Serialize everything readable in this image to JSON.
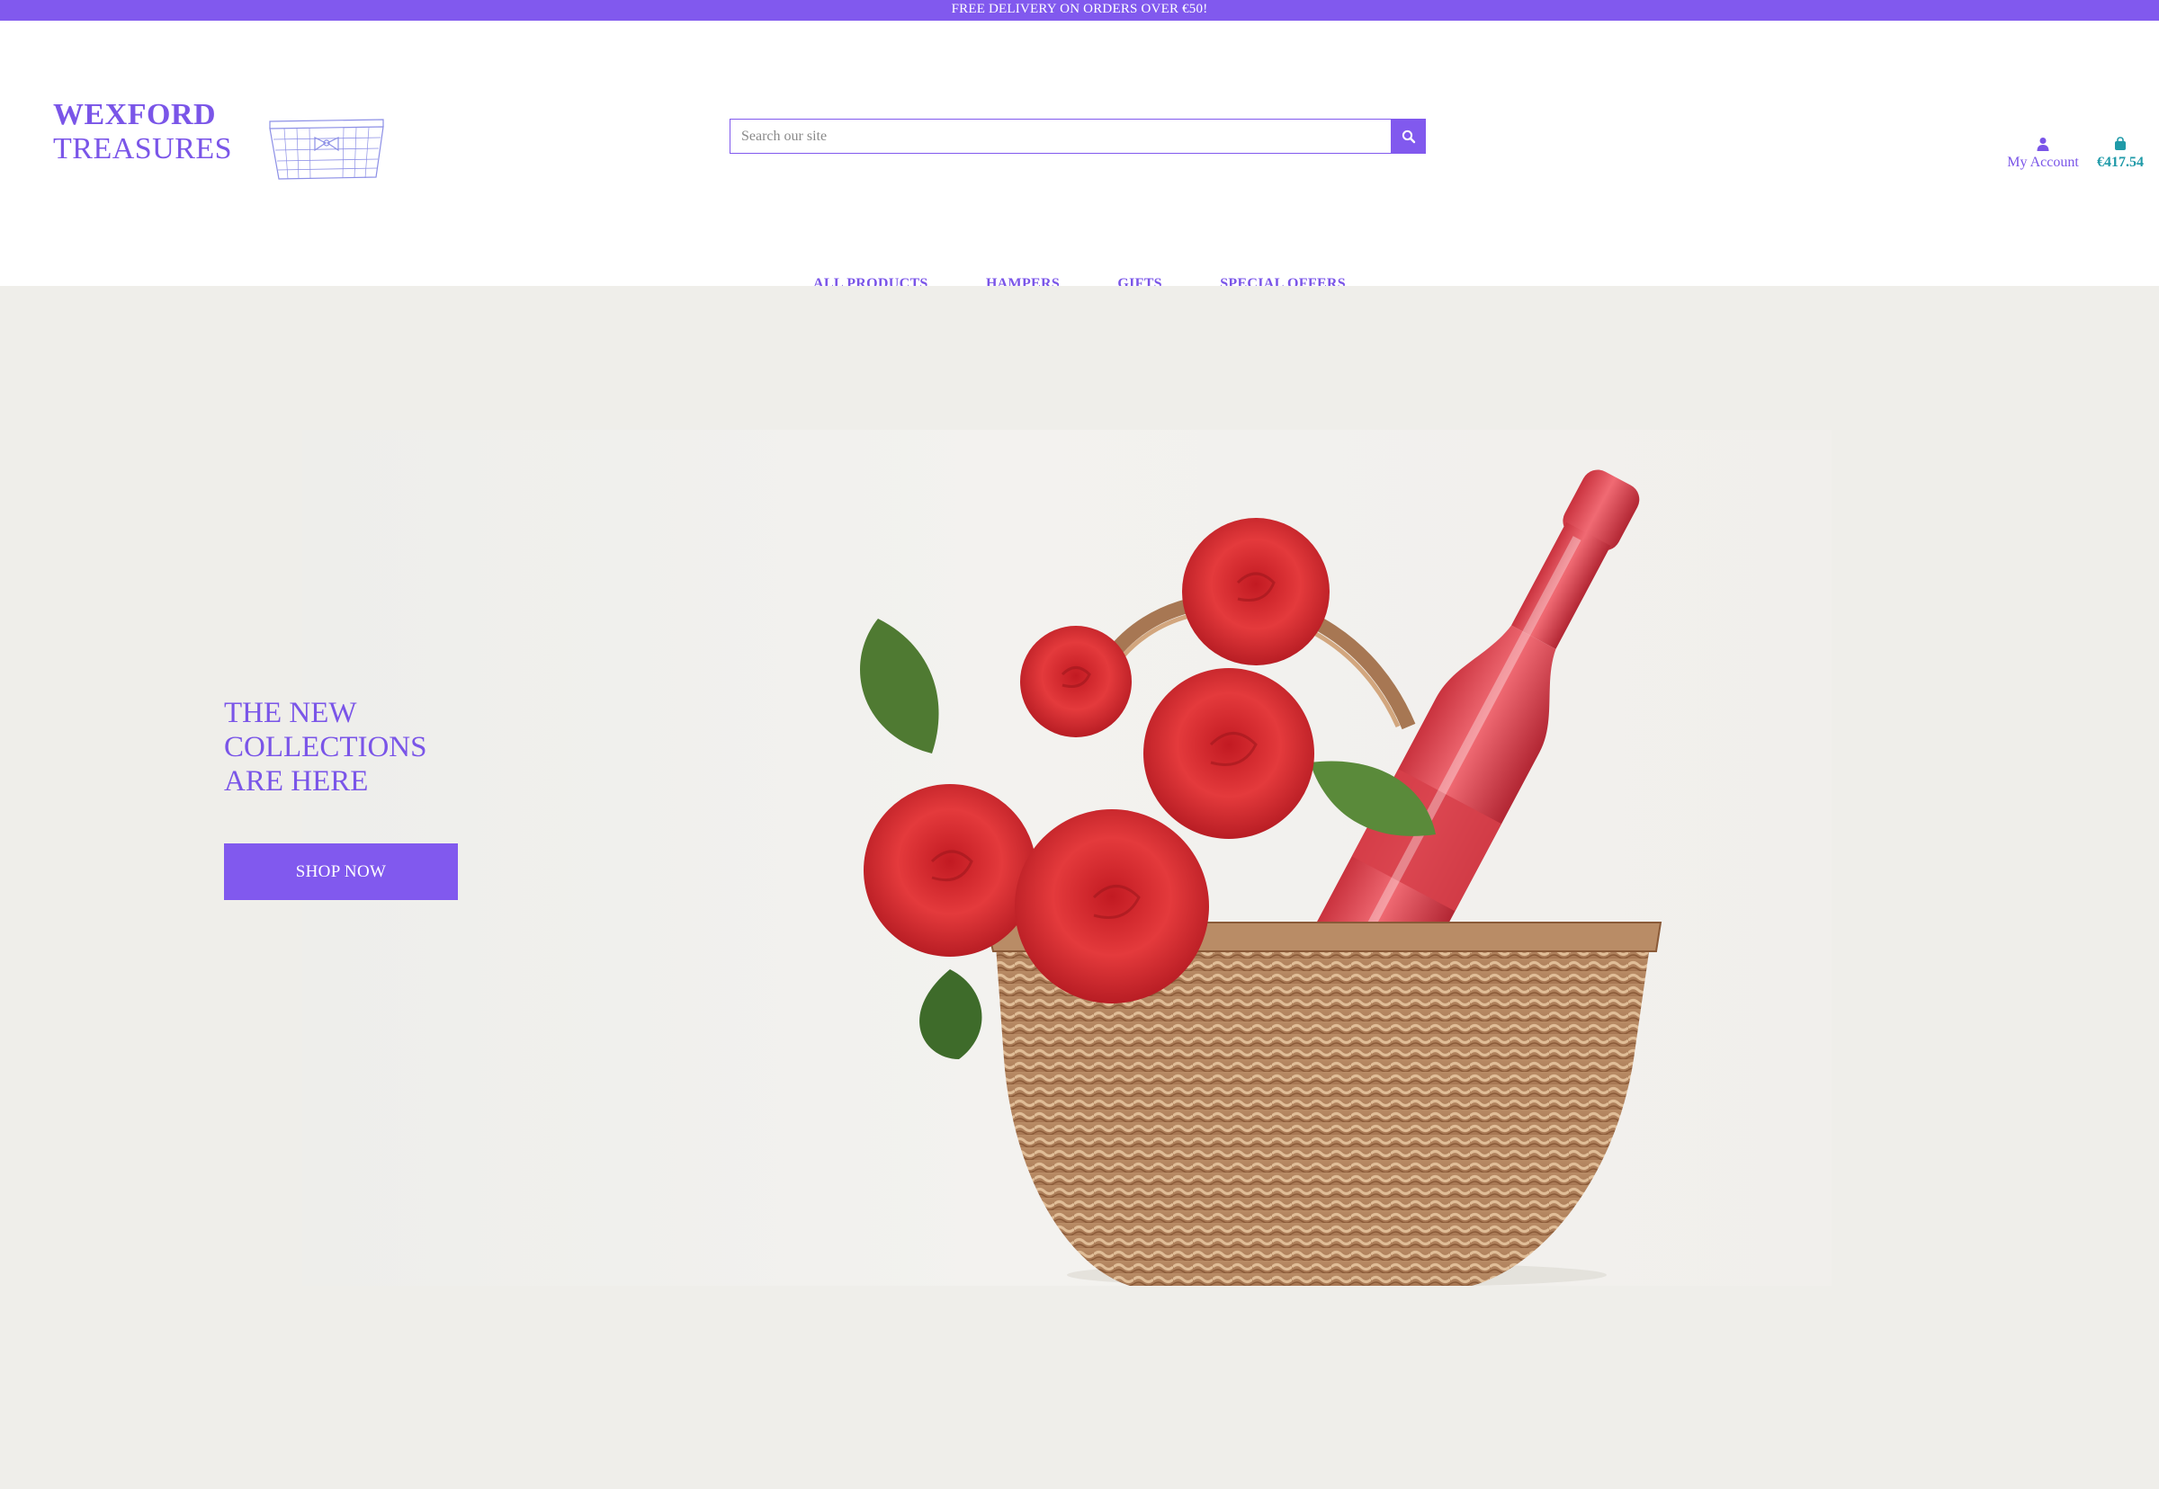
{
  "promo": {
    "text": "FREE DELIVERY ON ORDERS OVER €50!"
  },
  "brand": {
    "name_line1": "WEXFORD",
    "name_line2": "TREASURES"
  },
  "search": {
    "placeholder": "Search our site",
    "value": ""
  },
  "account": {
    "label": "My Account",
    "icon": "user-icon"
  },
  "cart": {
    "total": "€417.54",
    "icon": "shopping-bag-icon"
  },
  "nav": {
    "items": [
      {
        "label": "ALL PRODUCTS"
      },
      {
        "label": "HAMPERS"
      },
      {
        "label": "GIFTS"
      },
      {
        "label": "SPECIAL OFFERS"
      }
    ]
  },
  "hero": {
    "heading": "THE NEW\nCOLLECTIONS\nARE HERE",
    "button_label": "SHOP NOW",
    "image": "roses-and-bottle-in-wicker-basket"
  },
  "colors": {
    "brand_purple": "#8159ee",
    "cart_teal": "#1f9aa8",
    "hero_bg": "#efeeea"
  }
}
